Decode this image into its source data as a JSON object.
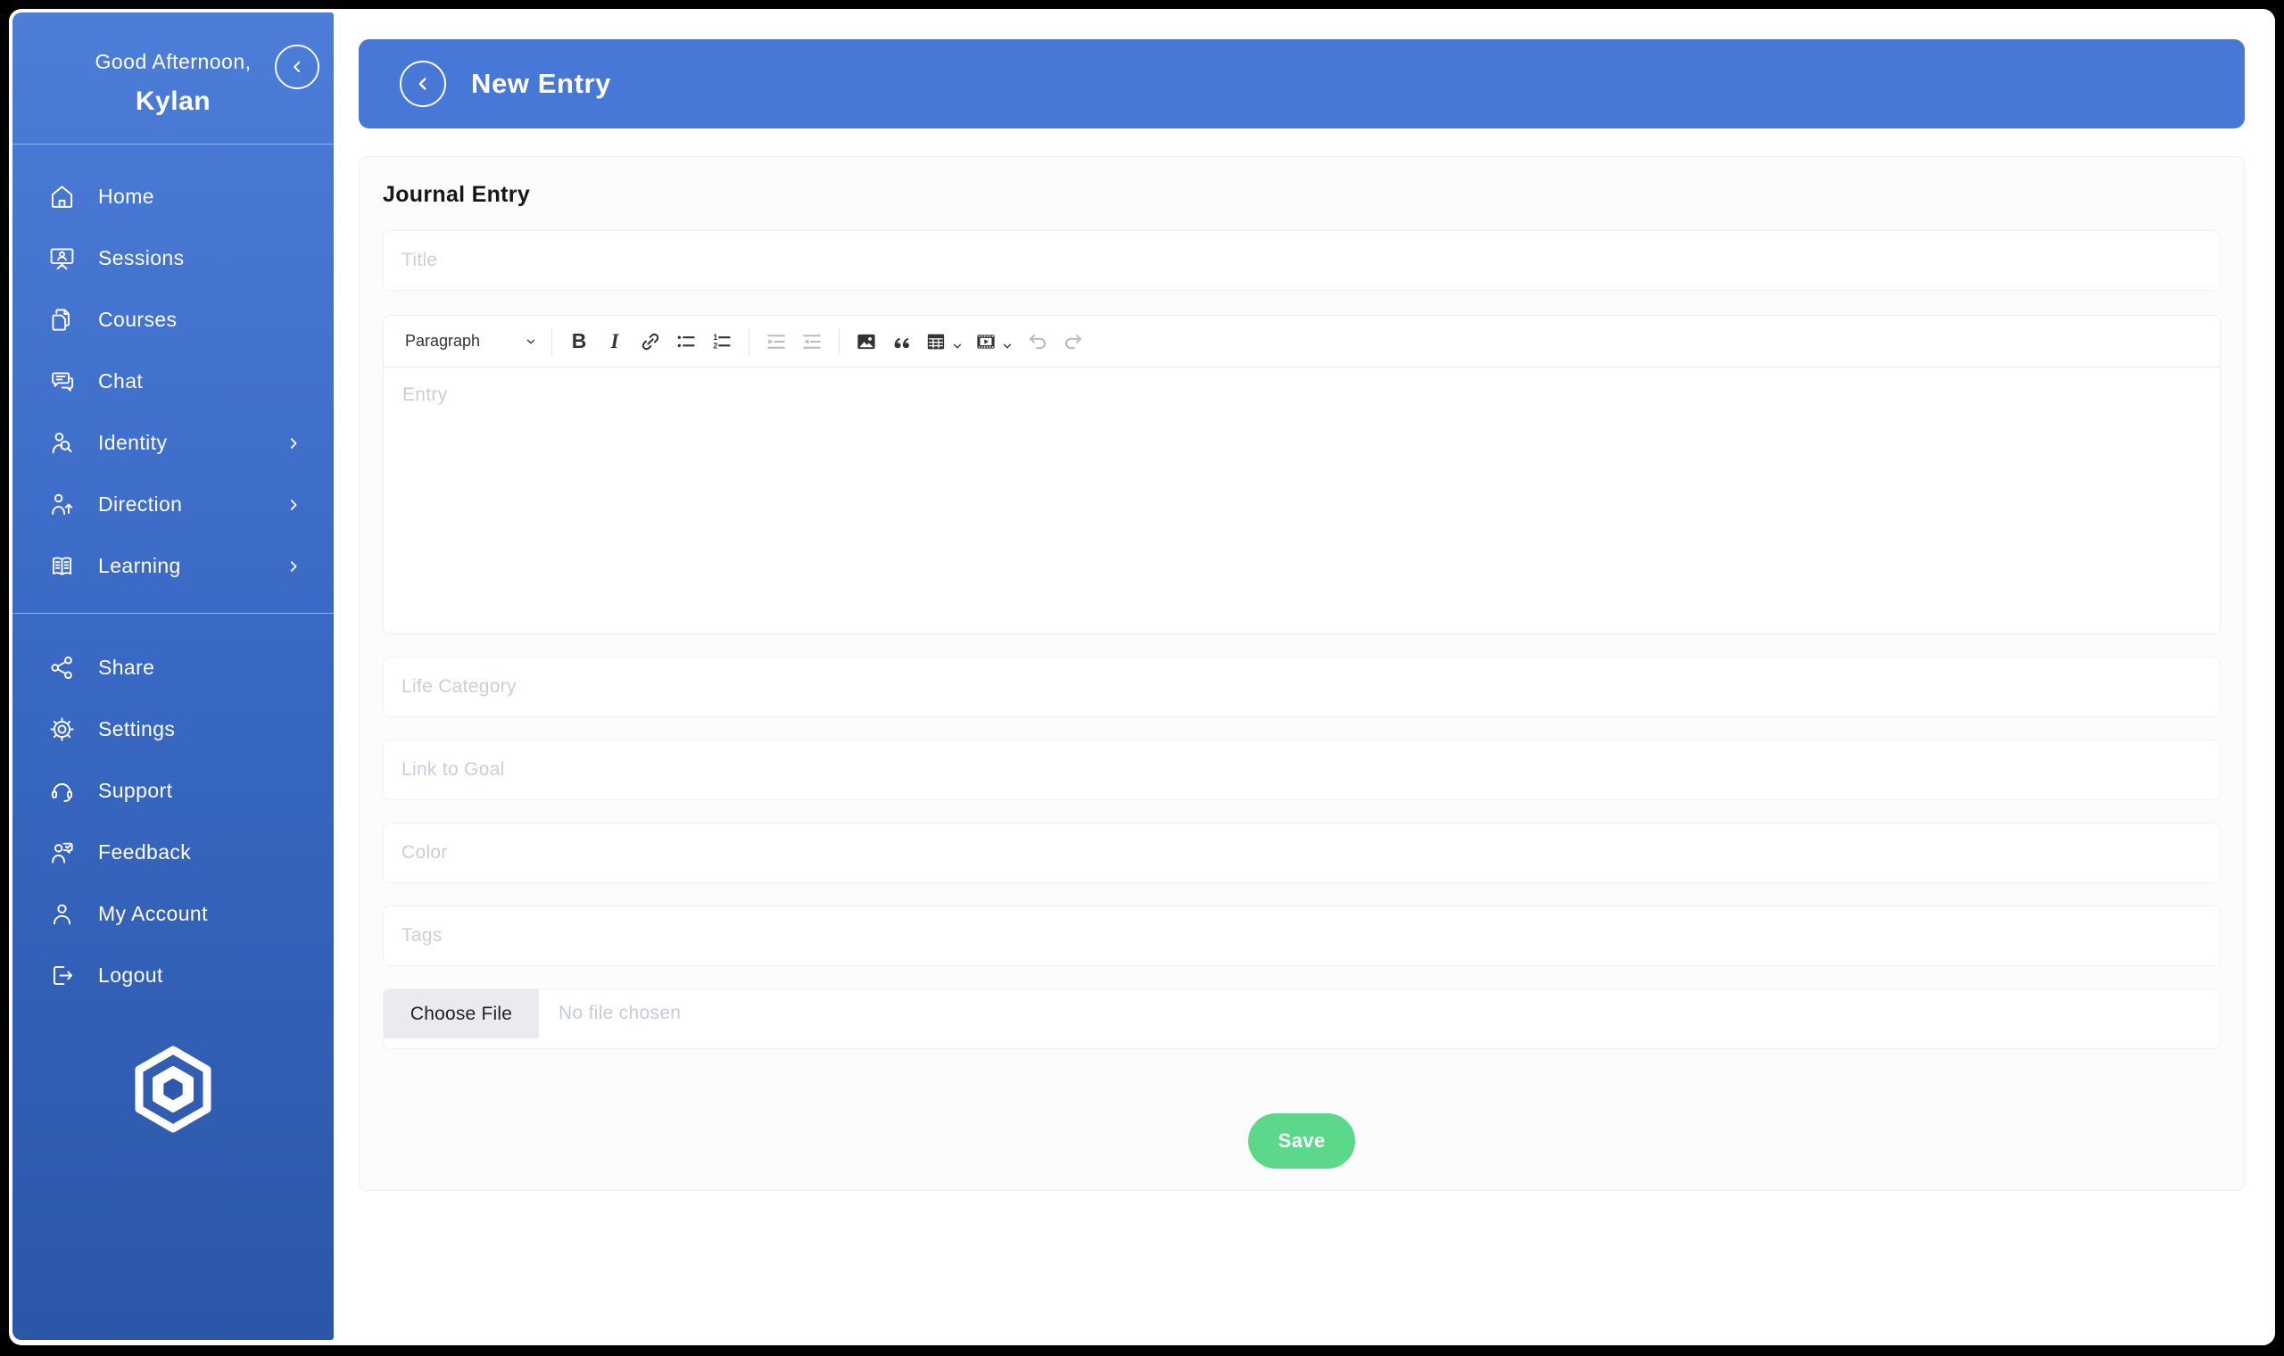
{
  "sidebar": {
    "greeting": "Good Afternoon,",
    "username": "Kylan",
    "collapse_icon": "chevron-left-icon",
    "colors": {
      "gradient_top": "#4c7dd9",
      "gradient_bottom": "#2c56a8"
    },
    "nav_items": [
      {
        "label": "Home",
        "icon": "home-icon",
        "expandable": false
      },
      {
        "label": "Sessions",
        "icon": "sessions-icon",
        "expandable": false
      },
      {
        "label": "Courses",
        "icon": "courses-icon",
        "expandable": false
      },
      {
        "label": "Chat",
        "icon": "chat-icon",
        "expandable": false
      },
      {
        "label": "Identity",
        "icon": "identity-icon",
        "expandable": true
      },
      {
        "label": "Direction",
        "icon": "direction-icon",
        "expandable": true
      },
      {
        "label": "Learning",
        "icon": "learning-icon",
        "expandable": true
      }
    ],
    "footer_items": [
      {
        "label": "Share",
        "icon": "share-icon"
      },
      {
        "label": "Settings",
        "icon": "settings-icon"
      },
      {
        "label": "Support",
        "icon": "support-icon"
      },
      {
        "label": "Feedback",
        "icon": "feedback-icon"
      },
      {
        "label": "My Account",
        "icon": "my-account-icon"
      },
      {
        "label": "Logout",
        "icon": "logout-icon"
      }
    ],
    "logo": "hexagon-logo"
  },
  "header": {
    "title": "New Entry",
    "back_icon": "chevron-left-icon",
    "background": "#4878d7"
  },
  "form": {
    "section_label": "Journal Entry",
    "title_field": {
      "placeholder": "Title",
      "value": ""
    },
    "editor": {
      "paragraph_dropdown": {
        "value": "Paragraph"
      },
      "toolbar_buttons": [
        "bold",
        "italic",
        "link",
        "bulleted-list",
        "numbered-list",
        "outdent",
        "indent",
        "insert-image",
        "block-quote",
        "insert-table",
        "insert-media",
        "undo",
        "redo"
      ],
      "disabled_buttons": [
        "outdent",
        "indent",
        "undo",
        "redo"
      ],
      "entry_placeholder": "Entry",
      "value": ""
    },
    "fields": [
      {
        "placeholder": "Life Category",
        "value": ""
      },
      {
        "placeholder": "Link to Goal",
        "value": ""
      },
      {
        "placeholder": "Color",
        "value": ""
      },
      {
        "placeholder": "Tags",
        "value": ""
      }
    ],
    "file_field": {
      "button_label": "Choose File",
      "status": "No file chosen"
    },
    "save_button": {
      "label": "Save",
      "color": "#5bd88a"
    }
  }
}
